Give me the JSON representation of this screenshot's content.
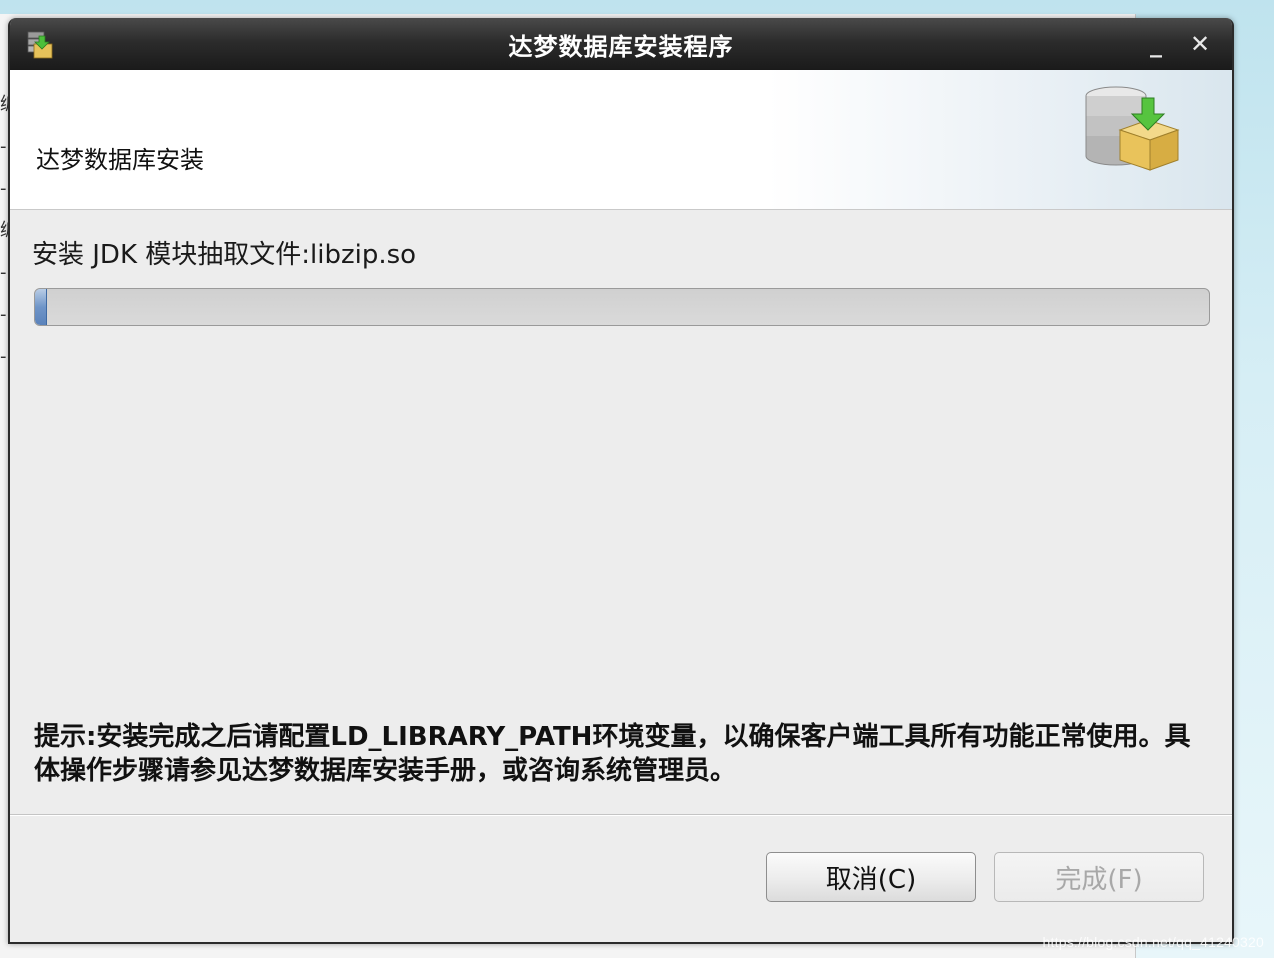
{
  "window": {
    "title": "达梦数据库安装程序",
    "minimize_glyph": "_",
    "close_glyph": "✕"
  },
  "header": {
    "title": "达梦数据库安装"
  },
  "progress": {
    "status": "安装 JDK 模块抽取文件:libzip.so",
    "fraction": 0.01
  },
  "hint": {
    "text": "提示:安装完成之后请配置LD_LIBRARY_PATH环境变量，以确保客户端工具所有功能正常使用。具体操作步骤请参见达梦数据库安装手册，或咨询系统管理员。"
  },
  "buttons": {
    "cancel": "取消(C)",
    "finish": "完成(F)",
    "finish_enabled": false
  },
  "background": {
    "edge_glyphs": [
      "编",
      "-",
      "-",
      "编",
      "-",
      "-",
      "-"
    ]
  },
  "watermark": "https://blog.csdn.net/qq_41240320",
  "colors": {
    "titlebar": "#2c2c2c",
    "progress_fill": "#6f95c8",
    "dialog_bg": "#ededed"
  }
}
